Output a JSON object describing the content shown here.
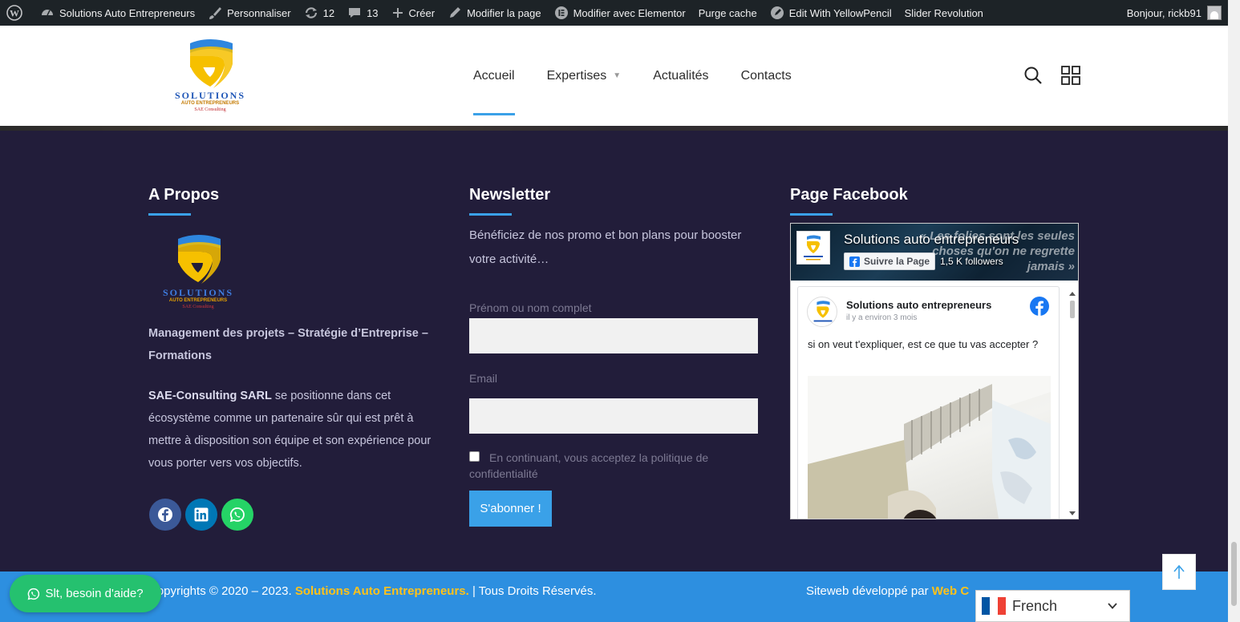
{
  "admin_bar": {
    "site_name": "Solutions Auto Entrepreneurs",
    "customize": "Personnaliser",
    "updates_count": "12",
    "comments_count": "13",
    "new": "Créer",
    "edit_page": "Modifier la page",
    "edit_elementor": "Modifier avec Elementor",
    "purge_cache": "Purge cache",
    "yellowpencil": "Edit With YellowPencil",
    "slider": "Slider Revolution",
    "greeting": "Bonjour, rickb91"
  },
  "header": {
    "logo_main": "SOLUTIONS",
    "logo_sub": "AUTO ENTREPRENEURS",
    "logo_tag": "SAE Consulting",
    "nav": [
      {
        "label": "Accueil",
        "active": true
      },
      {
        "label": "Expertises",
        "has_caret": true
      },
      {
        "label": "Actualités"
      },
      {
        "label": "Contacts"
      }
    ]
  },
  "footer": {
    "about": {
      "title": "A Propos",
      "tagline": "Management des projets – Stratégie d’Entreprise – Formations",
      "company": "SAE-Consulting SARL",
      "body": " se positionne dans cet écosystème comme un partenaire sûr qui est prêt à mettre à disposition son équipe et son expérience pour vous porter vers vos objectifs.",
      "socials": [
        {
          "icon": "facebook-icon",
          "color": "#3b5998"
        },
        {
          "icon": "linkedin-icon",
          "color": "#0077b5"
        },
        {
          "icon": "whatsapp-icon",
          "color": "#25d366"
        }
      ]
    },
    "newsletter": {
      "title": "Newsletter",
      "text": "Bénéficiez de nos promo et bon plans pour booster votre activité…",
      "name_label": "Prénom ou nom complet",
      "email_label": "Email",
      "policy": "En continuant, vous acceptez la politique de confidentialité",
      "submit": "S'abonner !"
    },
    "facebook": {
      "title": "Page Facebook",
      "page_name": "Solutions auto entrepreneurs",
      "follow_button": "Suivre la Page",
      "followers": "1,5 K followers",
      "cover_quote": "« Les folies sont les seules choses qu'on ne regrette jamais »",
      "post_author": "Solutions auto entrepreneurs",
      "post_time": "il y a environ 3 mois",
      "post_text": "si on veut t'expliquer, est ce que tu vas accepter ?"
    }
  },
  "bottom_bar": {
    "copyright_prefix": "Copyrights © 2020 – 2023. ",
    "copyright_brand": "Solutions Auto Entrepreneurs.",
    "copyright_suffix": " | Tous Droits Réservés.",
    "dev_prefix": "Siteweb développé par ",
    "dev_brand": "Web C"
  },
  "whatsapp_button": "Slt, besoin d'aide?",
  "language": {
    "selected": "French"
  },
  "colors": {
    "accent": "#3aa1e8",
    "footer_bg": "#221d3a",
    "brand_yellow": "#ffc21a",
    "whatsapp": "#25c16f"
  }
}
